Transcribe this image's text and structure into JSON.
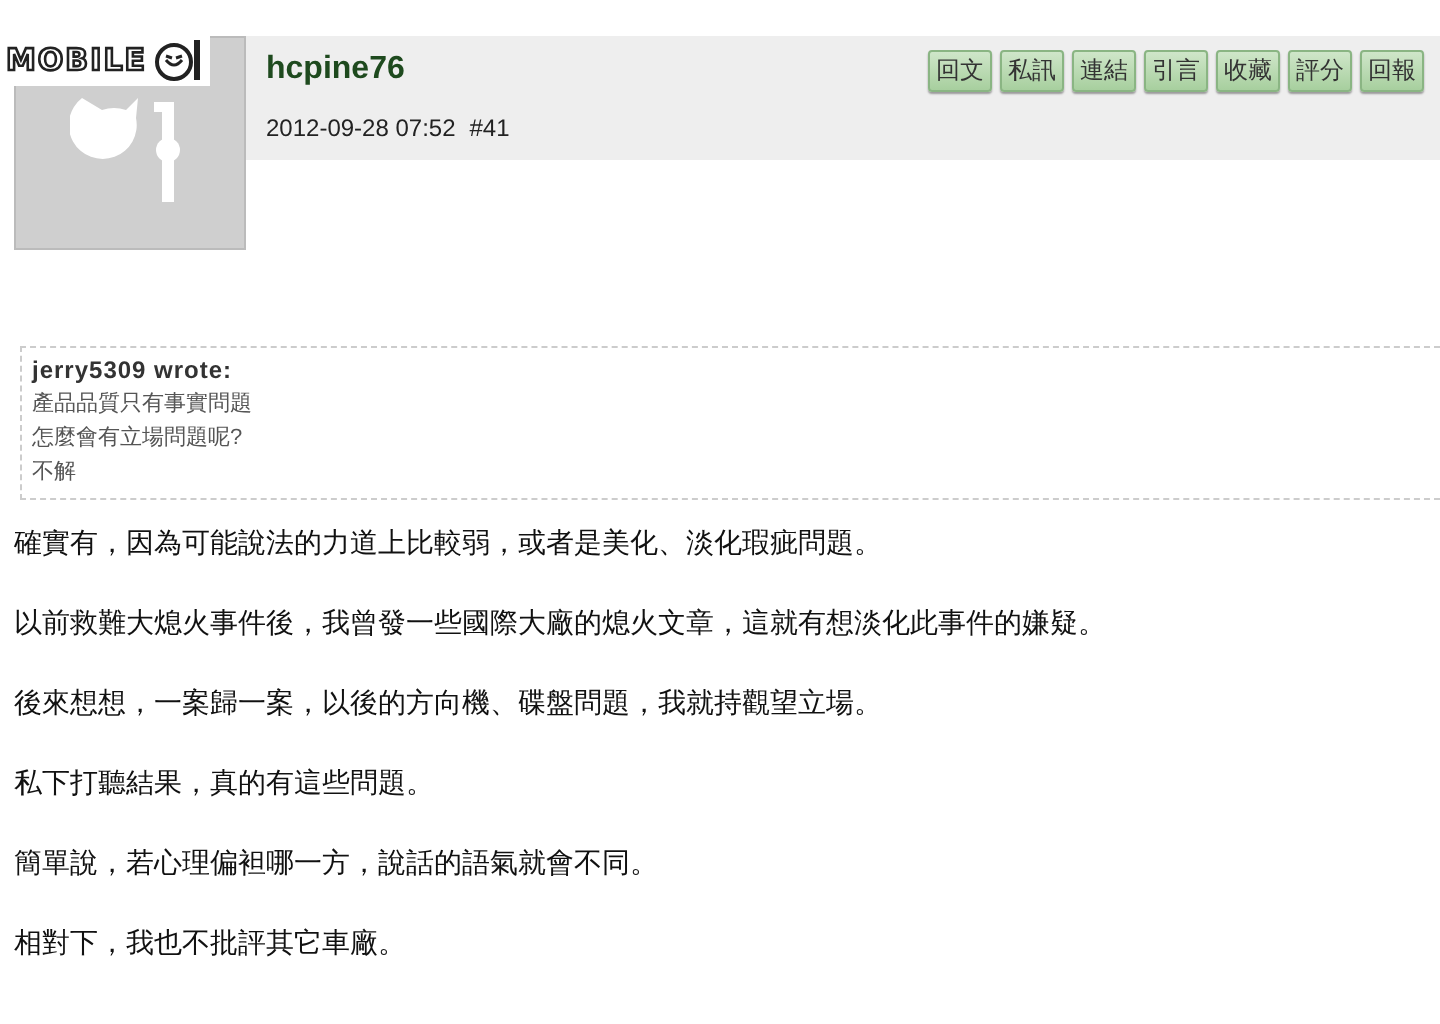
{
  "logo": {
    "text": "MOBILE"
  },
  "post": {
    "author": "hcpine76",
    "timestamp": "2012-09-28 07:52",
    "floor": "#41",
    "actions": [
      "回文",
      "私訊",
      "連結",
      "引言",
      "收藏",
      "評分",
      "回報"
    ],
    "quote": {
      "author_line": "jerry5309 wrote:",
      "lines": [
        "產品品質只有事實問題",
        "怎麼會有立場問題呢?",
        "不解"
      ]
    },
    "paragraphs": [
      "確實有，因為可能說法的力道上比較弱，或者是美化、淡化瑕疵問題。",
      "以前救難大熄火事件後，我曾發一些國際大廠的熄火文章，這就有想淡化此事件的嫌疑。",
      "後來想想，一案歸一案，以後的方向機、碟盤問題，我就持觀望立場。",
      "私下打聽結果，真的有這些問題。",
      "簡單說，若心理偏袒哪一方，說話的語氣就會不同。",
      "相對下，我也不批評其它車廠。"
    ]
  }
}
